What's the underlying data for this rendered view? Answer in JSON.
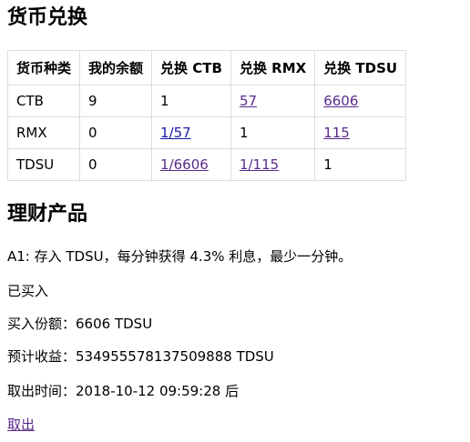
{
  "exchange": {
    "heading": "货币兑换",
    "columns": [
      "货币种类",
      "我的余额",
      "兑换 CTB",
      "兑换 RMX",
      "兑换 TDSU"
    ],
    "rows": [
      {
        "currency": "CTB",
        "balance": "9",
        "to_ctb": "1",
        "to_rmx": "57",
        "to_tdsu": "6606"
      },
      {
        "currency": "RMX",
        "balance": "0",
        "to_ctb": "1/57",
        "to_rmx": "1",
        "to_tdsu": "115"
      },
      {
        "currency": "TDSU",
        "balance": "0",
        "to_ctb": "1/6606",
        "to_rmx": "1/115",
        "to_tdsu": "1"
      }
    ]
  },
  "products": {
    "heading": "理财产品",
    "description": "A1: 存入 TDSU，每分钟获得 4.3% 利息，最少一分钟。",
    "status": "已买入",
    "amount_label": "买入份额：",
    "amount_value": "6606 TDSU",
    "yield_label": "预计收益：",
    "yield_value": "534955578137509888 TDSU",
    "time_label": "取出时间：",
    "time_value": "2018-10-12 09:59:28 后",
    "withdraw_label": "取出"
  },
  "colors": {
    "link_visited": "#5a2a8a",
    "link": "#1a1aa6",
    "border": "#dcdcdc"
  }
}
